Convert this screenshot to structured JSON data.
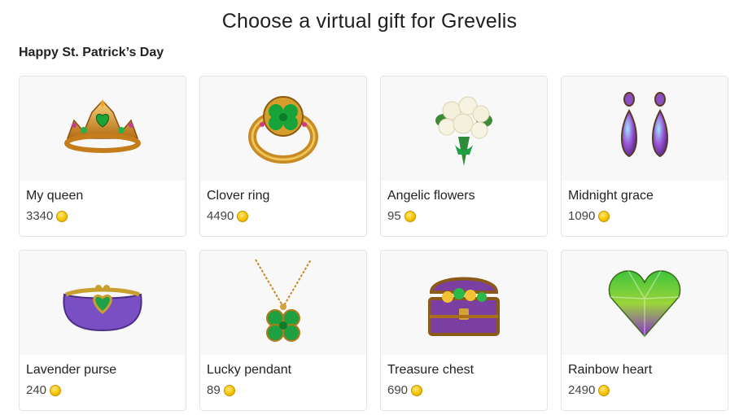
{
  "page": {
    "title": "Choose a virtual gift for Grevelis",
    "section_title": "Happy St. Patrick’s Day"
  },
  "colors": {
    "coin": "#f6c400",
    "card_border": "#e4e4e4",
    "image_bg": "#f8f8f8"
  },
  "gifts": [
    {
      "name": "My queen",
      "price": "3340",
      "icon": "crown-icon"
    },
    {
      "name": "Clover ring",
      "price": "4490",
      "icon": "clover-ring-icon"
    },
    {
      "name": "Angelic flowers",
      "price": "95",
      "icon": "bouquet-icon"
    },
    {
      "name": "Midnight grace",
      "price": "1090",
      "icon": "earrings-icon"
    },
    {
      "name": "Lavender purse",
      "price": "240",
      "icon": "purse-icon"
    },
    {
      "name": "Lucky pendant",
      "price": "89",
      "icon": "clover-pendant-icon"
    },
    {
      "name": "Treasure chest",
      "price": "690",
      "icon": "treasure-chest-icon"
    },
    {
      "name": "Rainbow heart",
      "price": "2490",
      "icon": "gem-heart-icon"
    }
  ]
}
